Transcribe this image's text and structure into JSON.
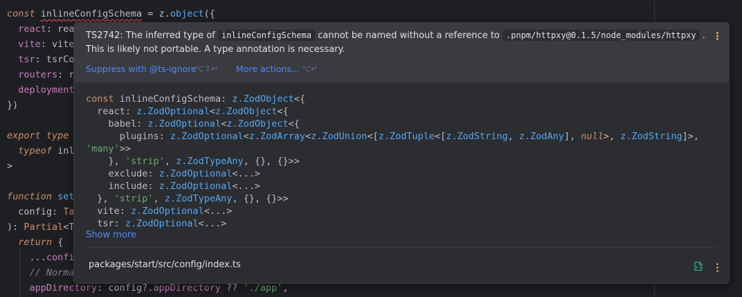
{
  "editor": {
    "lines": [
      [
        {
          "t": "const ",
          "c": "kw"
        },
        {
          "t": "inlineConfigSchema",
          "c": "typ wavy"
        },
        {
          "t": " = ",
          "c": "typ"
        },
        {
          "t": "z",
          "c": "ns"
        },
        {
          "t": ".",
          "c": "typ"
        },
        {
          "t": "object",
          "c": "fn"
        },
        {
          "t": "({",
          "c": "typ"
        }
      ],
      [
        {
          "t": "  ",
          "c": "typ"
        },
        {
          "t": "react",
          "c": "prop"
        },
        {
          "t": ": rea",
          "c": "typ"
        }
      ],
      [
        {
          "t": "  ",
          "c": "typ"
        },
        {
          "t": "vite",
          "c": "prop"
        },
        {
          "t": ": vite",
          "c": "typ"
        }
      ],
      [
        {
          "t": "  ",
          "c": "typ"
        },
        {
          "t": "tsr",
          "c": "prop"
        },
        {
          "t": ": tsrCo",
          "c": "typ"
        }
      ],
      [
        {
          "t": "  ",
          "c": "typ"
        },
        {
          "t": "routers",
          "c": "prop"
        },
        {
          "t": ": r",
          "c": "typ"
        }
      ],
      [
        {
          "t": "  ",
          "c": "typ"
        },
        {
          "t": "deployment",
          "c": "prop"
        }
      ],
      [
        {
          "t": "})",
          "c": "typ"
        }
      ],
      [],
      [
        {
          "t": "export type ",
          "c": "kw"
        }
      ],
      [
        {
          "t": "  ",
          "c": "typ"
        },
        {
          "t": "typeof ",
          "c": "kw"
        },
        {
          "t": "inl",
          "c": "typ"
        }
      ],
      [
        {
          "t": ">",
          "c": "typ"
        }
      ],
      [],
      [
        {
          "t": "function ",
          "c": "kw"
        },
        {
          "t": "set",
          "c": "fn"
        }
      ],
      [
        {
          "t": "  ",
          "c": "typ"
        },
        {
          "t": "config",
          "c": "typ"
        },
        {
          "t": ": ",
          "c": "typ"
        },
        {
          "t": "Ta",
          "c": "kwn"
        }
      ],
      [
        {
          "t": "): ",
          "c": "typ"
        },
        {
          "t": "Partial",
          "c": "kwn"
        },
        {
          "t": "<T",
          "c": "typ"
        }
      ],
      [
        {
          "t": "  ",
          "c": "typ"
        },
        {
          "t": "return",
          "c": "kw"
        },
        {
          "t": " {",
          "c": "typ"
        }
      ],
      [
        {
          "t": "    ...",
          "c": "typ"
        },
        {
          "t": "confi",
          "c": "prop"
        }
      ],
      [
        {
          "t": "    // Norma",
          "c": "cmt"
        }
      ],
      [
        {
          "t": "    ",
          "c": "typ"
        },
        {
          "t": "appDirectory",
          "c": "prop"
        },
        {
          "t": ": config?.",
          "c": "typ"
        },
        {
          "t": "appDirectory",
          "c": "prop"
        },
        {
          "t": " ?? ",
          "c": "typ"
        },
        {
          "t": "'./app'",
          "c": "str"
        },
        {
          "t": ",",
          "c": "typ"
        }
      ]
    ]
  },
  "popup": {
    "message": {
      "prefix": "TS2742: The inferred type of ",
      "symbol": "inlineConfigSchema",
      "middle": " cannot be named without a reference to ",
      "reference": ".pnpm/httpxy@0.1.5/node_modules/httpxy",
      "suffix": " .",
      "line2": "This is likely not portable. A type annotation is necessary."
    },
    "actions": {
      "suppress_label": "Suppress with @ts-ignore",
      "suppress_shortcut": "⌥⇧↵",
      "more_label": "More actions...",
      "more_shortcut": "⌥↵"
    },
    "signature": [
      [
        {
          "t": "const ",
          "c": "kwn"
        },
        {
          "t": "inlineConfigSchema: ",
          "c": "typ"
        },
        {
          "t": "z.ZodObject",
          "c": "zt"
        },
        {
          "t": "<{",
          "c": "typ"
        }
      ],
      [
        {
          "t": "  react: ",
          "c": "typ"
        },
        {
          "t": "z.ZodOptional",
          "c": "zt"
        },
        {
          "t": "<",
          "c": "typ"
        },
        {
          "t": "z.ZodObject",
          "c": "zt"
        },
        {
          "t": "<{",
          "c": "typ"
        }
      ],
      [
        {
          "t": "    babel: ",
          "c": "typ"
        },
        {
          "t": "z.ZodOptional",
          "c": "zt"
        },
        {
          "t": "<",
          "c": "typ"
        },
        {
          "t": "z.ZodObject",
          "c": "zt"
        },
        {
          "t": "<{",
          "c": "typ"
        }
      ],
      [
        {
          "t": "      plugins: ",
          "c": "typ"
        },
        {
          "t": "z.ZodOptional",
          "c": "zt"
        },
        {
          "t": "<",
          "c": "typ"
        },
        {
          "t": "z.ZodArray",
          "c": "zt"
        },
        {
          "t": "<",
          "c": "typ"
        },
        {
          "t": "z.ZodUnion",
          "c": "zt"
        },
        {
          "t": "<[",
          "c": "typ"
        },
        {
          "t": "z.ZodTuple",
          "c": "zt"
        },
        {
          "t": "<[",
          "c": "typ"
        },
        {
          "t": "z.ZodString",
          "c": "zt"
        },
        {
          "t": ", ",
          "c": "typ"
        },
        {
          "t": "z.ZodAny",
          "c": "zt"
        },
        {
          "t": "], ",
          "c": "typ"
        },
        {
          "t": "null",
          "c": "kw"
        },
        {
          "t": ">, ",
          "c": "typ"
        },
        {
          "t": "z.ZodString",
          "c": "zt"
        },
        {
          "t": "]>,",
          "c": "typ"
        }
      ],
      [
        {
          "t": "'many'",
          "c": "str"
        },
        {
          "t": ">>",
          "c": "typ"
        }
      ],
      [
        {
          "t": "    }, ",
          "c": "typ"
        },
        {
          "t": "'strip'",
          "c": "str"
        },
        {
          "t": ", ",
          "c": "typ"
        },
        {
          "t": "z.ZodTypeAny",
          "c": "zt"
        },
        {
          "t": ", {}, {}>>",
          "c": "typ"
        }
      ],
      [
        {
          "t": "    exclude: ",
          "c": "typ"
        },
        {
          "t": "z.ZodOptional",
          "c": "zt"
        },
        {
          "t": "<...>",
          "c": "typ"
        }
      ],
      [
        {
          "t": "    include: ",
          "c": "typ"
        },
        {
          "t": "z.ZodOptional",
          "c": "zt"
        },
        {
          "t": "<...>",
          "c": "typ"
        }
      ],
      [
        {
          "t": "  }, ",
          "c": "typ"
        },
        {
          "t": "'strip'",
          "c": "str"
        },
        {
          "t": ", ",
          "c": "typ"
        },
        {
          "t": "z.ZodTypeAny",
          "c": "zt"
        },
        {
          "t": ", {}, {}>>",
          "c": "typ"
        }
      ],
      [
        {
          "t": "  vite: ",
          "c": "typ"
        },
        {
          "t": "z.ZodOptional",
          "c": "zt"
        },
        {
          "t": "<...>",
          "c": "typ"
        }
      ],
      [
        {
          "t": "  tsr: ",
          "c": "typ"
        },
        {
          "t": "z.ZodOptional",
          "c": "zt"
        },
        {
          "t": "<...>",
          "c": "typ"
        }
      ]
    ],
    "show_more_label": "Show more",
    "file_path": "packages/start/src/config/index.ts",
    "icons": {
      "header_menu": "more-vertical-icon",
      "footer_menu": "more-vertical-icon",
      "file": "file-source-icon"
    },
    "colors": {
      "warning_accent": "#e8b53d",
      "link": "#548af7",
      "file_icon": "#2fb389"
    }
  }
}
